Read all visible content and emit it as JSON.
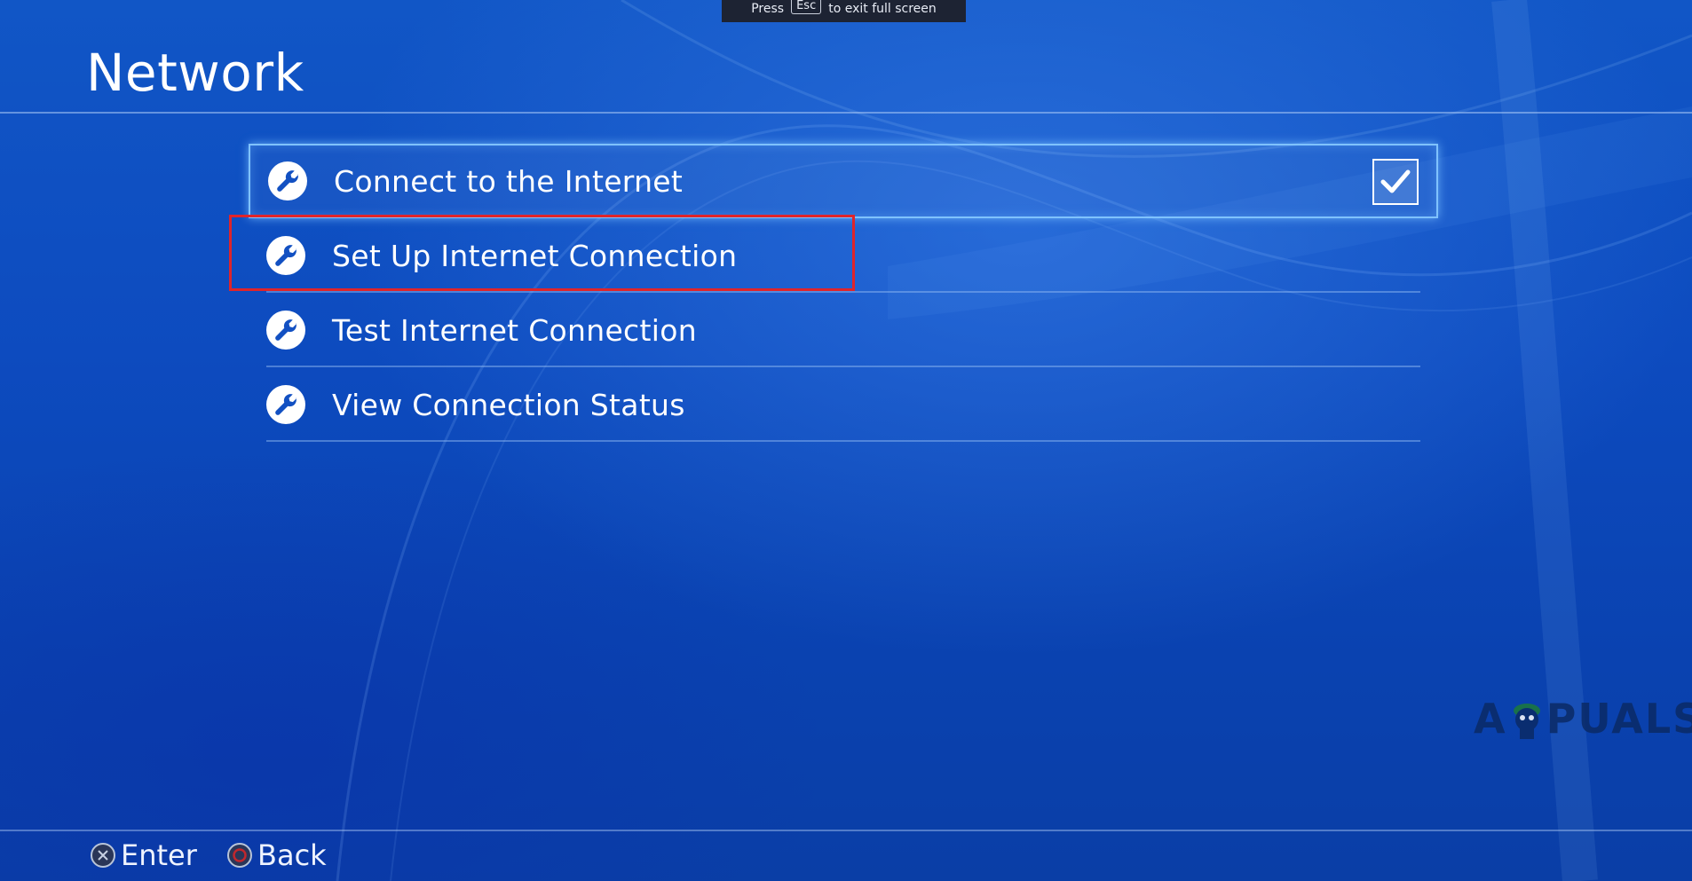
{
  "toast": {
    "prefix": "Press",
    "key": "Esc",
    "suffix": "to exit full screen"
  },
  "page": {
    "title": "Network"
  },
  "menu": {
    "items": [
      {
        "label": "Connect to the Internet",
        "icon": "wrench-icon",
        "checked": true
      },
      {
        "label": "Set Up Internet Connection",
        "icon": "wrench-icon"
      },
      {
        "label": "Test Internet Connection",
        "icon": "wrench-icon"
      },
      {
        "label": "View Connection Status",
        "icon": "wrench-icon"
      }
    ]
  },
  "footer": {
    "enter_label": "Enter",
    "back_label": "Back",
    "enter_icon": "cross-button-icon",
    "back_icon": "circle-button-icon"
  },
  "watermark": {
    "text_left": "A",
    "text_right": "PUALS"
  },
  "colors": {
    "background": "#0b46b8",
    "focus_border": "#7fc2ff",
    "annotation_red": "#e0242a",
    "back_circle": "#c0272d"
  }
}
